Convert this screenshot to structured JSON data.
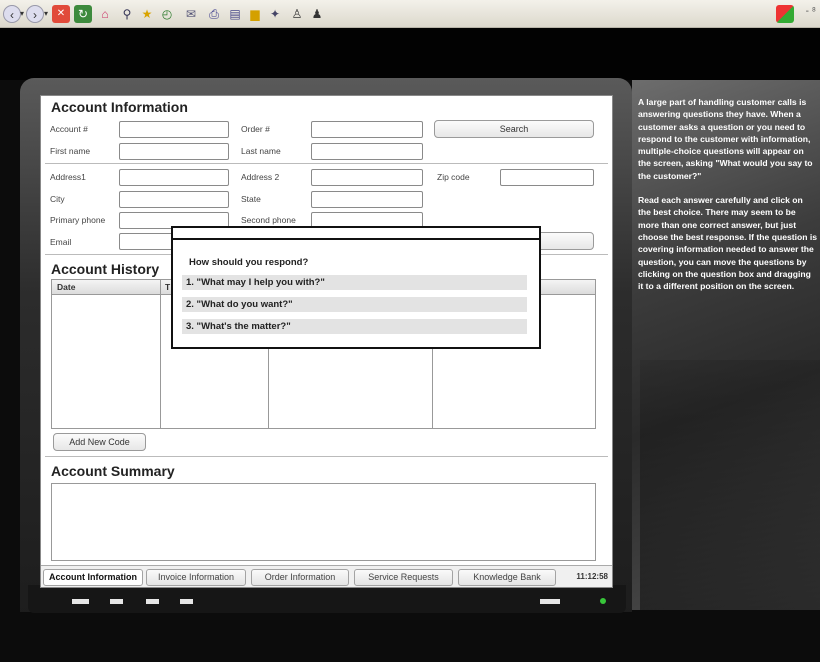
{
  "browser": {
    "icons": [
      "back-icon",
      "forward-icon",
      "stop-icon",
      "refresh-icon",
      "home-icon",
      "search-icon",
      "favorites-icon",
      "history-icon",
      "mail-icon",
      "print-icon",
      "edit-icon",
      "folder-icon",
      "messenger-icon",
      "user-icon",
      "users-icon"
    ],
    "window_controls": "- ⁸"
  },
  "account_information": {
    "title": "Account Information",
    "fields": {
      "account_num": {
        "label": "Account #",
        "value": ""
      },
      "order_num": {
        "label": "Order #",
        "value": ""
      },
      "first_name": {
        "label": "First name",
        "value": ""
      },
      "last_name": {
        "label": "Last name",
        "value": ""
      },
      "address1": {
        "label": "Address1",
        "value": ""
      },
      "address2": {
        "label": "Address 2",
        "value": ""
      },
      "zip": {
        "label": "Zip code",
        "value": ""
      },
      "city": {
        "label": "City",
        "value": ""
      },
      "state": {
        "label": "State",
        "value": ""
      },
      "primary_phone": {
        "label": "Primary phone",
        "value": ""
      },
      "second_phone": {
        "label": "Second phone",
        "value": ""
      },
      "email": {
        "label": "Email",
        "value": ""
      }
    },
    "search_button": "Search"
  },
  "account_history": {
    "title": "Account History",
    "columns": [
      "Date",
      "T"
    ],
    "add_button": "Add New Code"
  },
  "account_summary": {
    "title": "Account Summary"
  },
  "tabs": [
    "Account Information",
    "Invoice Information",
    "Order Information",
    "Service Requests",
    "Knowledge Bank"
  ],
  "active_tab": "Account Information",
  "clock": "11:12:58",
  "dialog": {
    "question": "How should you respond?",
    "answers": [
      "1. \"What may I help you with?\"",
      "2. \"What do you want?\"",
      "3. \"What's the matter?\""
    ]
  },
  "instructions": [
    "A large part of handling customer calls is answering questions they have. When a customer asks a question or you need to respond to the customer with information, multiple-choice questions will appear on the screen, asking \"What would you say to the customer?\"",
    "Read each answer carefully and click on the best choice.  There may seem to be more than one correct answer, but just choose the best response. If the question is covering information needed to answer the question, you can move the questions by clicking on the question box and dragging it to a different position on the screen."
  ]
}
